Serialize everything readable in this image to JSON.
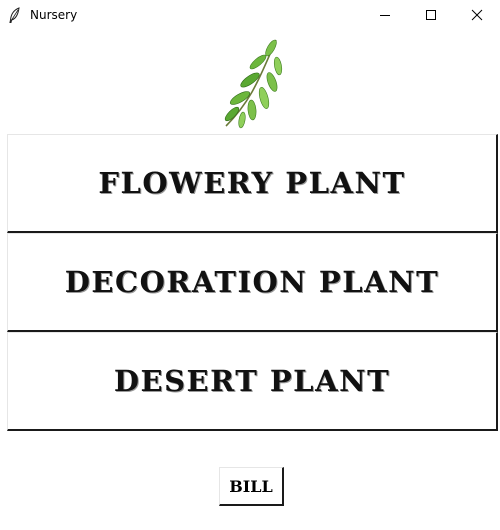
{
  "window": {
    "title": "Nursery",
    "icon": "feather-icon",
    "controls": {
      "minimize_icon": "minimize-icon",
      "maximize_icon": "maximize-icon",
      "close_icon": "close-icon"
    }
  },
  "logo": {
    "icon": "leaf-branch-icon"
  },
  "menu": {
    "items": [
      {
        "label": "FLOWERY PLANT"
      },
      {
        "label": "DECORATION PLANT"
      },
      {
        "label": "DESERT PLANT"
      }
    ]
  },
  "actions": {
    "bill_label": "BILL"
  },
  "colors": {
    "background": "#ffffff",
    "text": "#111111",
    "button_border_dark": "#1a1a1a",
    "leaf_green": "#5aa832"
  }
}
